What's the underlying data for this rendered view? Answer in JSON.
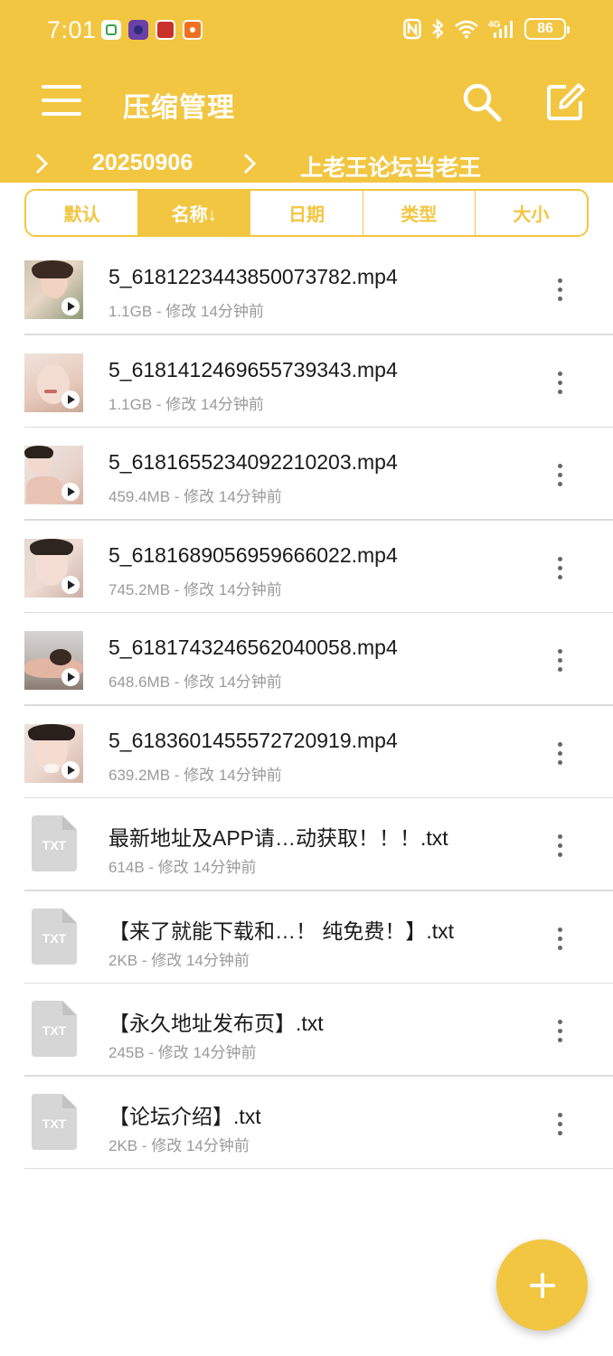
{
  "status_bar": {
    "time": "7:01",
    "app_icons": [
      "home-app-icon",
      "camera-app-icon",
      "red-app-icon",
      "orange-app-icon"
    ],
    "battery": "86",
    "network": "4G"
  },
  "app_bar": {
    "title": "压缩管理",
    "menu_icon": "menu-icon",
    "search_icon": "search-icon",
    "edit_icon": "edit-icon"
  },
  "breadcrumb": [
    "20250906",
    "上老王论坛当老王"
  ],
  "sort_tabs": [
    {
      "label": "默认",
      "active": false
    },
    {
      "label": "名称↓",
      "active": true
    },
    {
      "label": "日期",
      "active": false
    },
    {
      "label": "类型",
      "active": false
    },
    {
      "label": "大小",
      "active": false
    }
  ],
  "files": [
    {
      "name": "5_6181223443850073782.mp4",
      "meta": "1.1GB - 修改 14分钟前",
      "type": "video"
    },
    {
      "name": "5_6181412469655739343.mp4",
      "meta": "1.1GB - 修改 14分钟前",
      "type": "video"
    },
    {
      "name": "5_6181655234092210203.mp4",
      "meta": "459.4MB - 修改 14分钟前",
      "type": "video"
    },
    {
      "name": "5_6181689056959666022.mp4",
      "meta": "745.2MB - 修改 14分钟前",
      "type": "video"
    },
    {
      "name": "5_6181743246562040058.mp4",
      "meta": "648.6MB - 修改 14分钟前",
      "type": "video"
    },
    {
      "name": "5_6183601455572720919.mp4",
      "meta": "639.2MB - 修改 14分钟前",
      "type": "video"
    },
    {
      "name": "最新地址及APP请…动获取！！！.txt",
      "meta": "614B - 修改 14分钟前",
      "type": "txt"
    },
    {
      "name": "【来了就能下载和…！ 纯免费！】.txt",
      "meta": "2KB - 修改 14分钟前",
      "type": "txt"
    },
    {
      "name": "【永久地址发布页】.txt",
      "meta": "245B - 修改 14分钟前",
      "type": "txt"
    },
    {
      "name": "【论坛介绍】.txt",
      "meta": "2KB - 修改 14分钟前",
      "type": "txt"
    }
  ],
  "txt_icon_label": "TXT",
  "fab": {
    "icon": "plus-icon"
  },
  "colors": {
    "accent": "#F2C641",
    "divider": "#dcdcdc",
    "meta_text": "#9a9a9a"
  }
}
